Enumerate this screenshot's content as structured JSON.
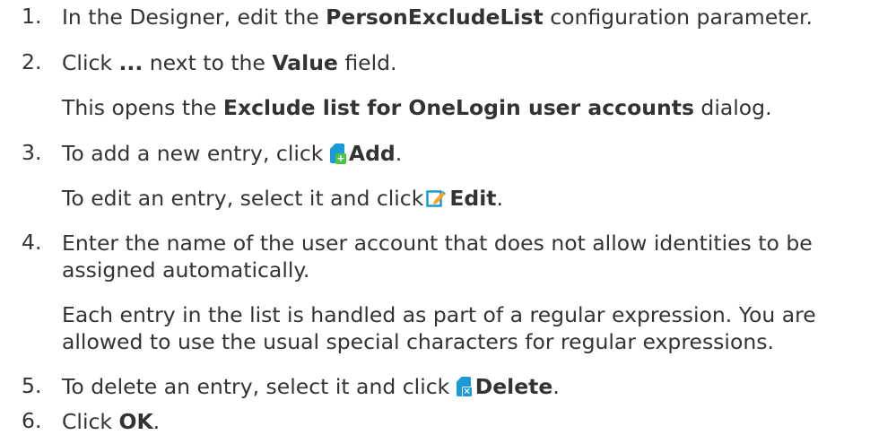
{
  "steps": [
    {
      "number": "1.",
      "lines": [
        {
          "segments": [
            {
              "text": "In the Designer, edit the ",
              "bold": false
            },
            {
              "text": "PersonExcludeList",
              "bold": true
            },
            {
              "text": " configuration parameter.",
              "bold": false
            }
          ]
        }
      ]
    },
    {
      "number": "2.",
      "lines": [
        {
          "segments": [
            {
              "text": "Click ",
              "bold": false
            },
            {
              "text": "...",
              "bold": true
            },
            {
              "text": " next to the ",
              "bold": false
            },
            {
              "text": "Value",
              "bold": true
            },
            {
              "text": " field.",
              "bold": false
            }
          ]
        },
        {
          "segments": [
            {
              "text": "This opens the ",
              "bold": false
            },
            {
              "text": "Exclude list for OneLogin user accounts",
              "bold": true
            },
            {
              "text": " dialog.",
              "bold": false
            }
          ]
        }
      ]
    },
    {
      "number": "3.",
      "lines": [
        {
          "segments": [
            {
              "text": "To add a new entry, click ",
              "bold": false
            },
            {
              "icon": "add-icon"
            },
            {
              "text": "Add",
              "bold": true
            },
            {
              "text": ".",
              "bold": false
            }
          ]
        },
        {
          "segments": [
            {
              "text": "To edit an entry, select it and click",
              "bold": false
            },
            {
              "icon": "edit-icon"
            },
            {
              "text": "Edit",
              "bold": true
            },
            {
              "text": ".",
              "bold": false
            }
          ]
        }
      ]
    },
    {
      "number": "4.",
      "lines": [
        {
          "segments": [
            {
              "text": "Enter the name of the user account that does not allow identities to be",
              "bold": false
            }
          ]
        },
        {
          "segments": [
            {
              "text": "assigned automatically.",
              "bold": false
            }
          ]
        },
        {
          "segments": [
            {
              "text": "Each entry in the list is handled as part of a regular expression. You are",
              "bold": false
            }
          ]
        },
        {
          "segments": [
            {
              "text": "allowed to use the usual special characters for regular expressions.",
              "bold": false
            }
          ]
        }
      ]
    },
    {
      "number": "5.",
      "lines": [
        {
          "segments": [
            {
              "text": "To delete an entry, select it and click ",
              "bold": false
            },
            {
              "icon": "delete-icon"
            },
            {
              "text": "Delete",
              "bold": true
            },
            {
              "text": ".",
              "bold": false
            }
          ]
        }
      ]
    },
    {
      "number": "6.",
      "lines": [
        {
          "segments": [
            {
              "text": "Click ",
              "bold": false
            },
            {
              "text": "OK",
              "bold": true
            },
            {
              "text": ".",
              "bold": false
            }
          ]
        }
      ]
    }
  ],
  "colors": {
    "text": "#333333",
    "icon_blue": "#1a9ad6",
    "icon_green": "#4dc247"
  }
}
